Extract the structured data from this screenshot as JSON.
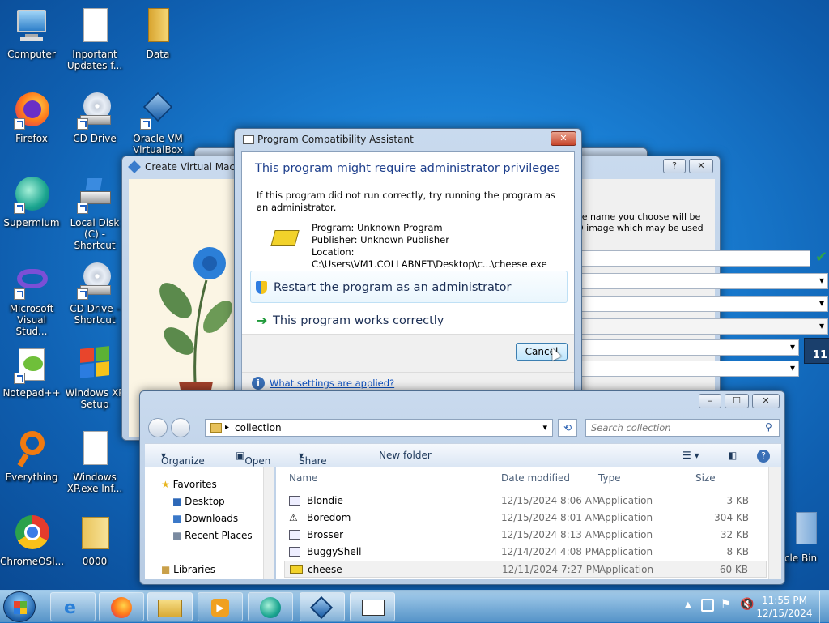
{
  "desktop_icons": [
    {
      "label": "Computer"
    },
    {
      "label": "Inportant Updates f..."
    },
    {
      "label": "Data"
    },
    {
      "label": "Firefox"
    },
    {
      "label": "CD Drive"
    },
    {
      "label": "Oracle VM VirtualBox"
    },
    {
      "label": "Supermium"
    },
    {
      "label": "Local Disk (C) - Shortcut"
    },
    {
      "label": "Microsoft Visual Stud..."
    },
    {
      "label": "CD Drive - Shortcut"
    },
    {
      "label": "Notepad++"
    },
    {
      "label": "Windows XP Setup"
    },
    {
      "label": "Everything"
    },
    {
      "label": "Windows XP.exe Inf..."
    },
    {
      "label": "ChromeOSI..."
    },
    {
      "label": "0000"
    },
    {
      "label": "cle Bin"
    }
  ],
  "pca": {
    "title": "Program Compatibility Assistant",
    "heading": "This program might require administrator privileges",
    "description": "If this program did not run correctly, try running the program as an administrator.",
    "program": "Program: Unknown Program",
    "publisher": "Publisher: Unknown Publisher",
    "location": "Location: C:\\Users\\VM1.COLLABNET\\Desktop\\c...\\cheese.exe",
    "option_restart": "Restart the program as an administrator",
    "option_works": "This program works correctly",
    "cancel": "Cancel",
    "settings_link": "What settings are applied?"
  },
  "cvm": {
    "title": "Create Virtual Machi",
    "help": "?",
    "hint_line1": "The name you choose will be",
    "hint_line2": "SO image which may be used",
    "badge": "11"
  },
  "explorer": {
    "address": "collection",
    "search_placeholder": "Search collection",
    "cmd": {
      "organize": "Organize",
      "open": "Open",
      "share": "Share with",
      "new_folder": "New folder"
    },
    "nav": {
      "favorites": "Favorites",
      "desktop": "Desktop",
      "downloads": "Downloads",
      "recent": "Recent Places",
      "libraries": "Libraries"
    },
    "columns": {
      "name": "Name",
      "date": "Date modified",
      "type": "Type",
      "size": "Size"
    },
    "rows": [
      {
        "name": "Blondie",
        "date": "12/15/2024 8:06 AM",
        "type": "Application",
        "size": "3 KB"
      },
      {
        "name": "Boredom",
        "date": "12/15/2024 8:01 AM",
        "type": "Application",
        "size": "304 KB"
      },
      {
        "name": "Brosser",
        "date": "12/15/2024 8:13 AM",
        "type": "Application",
        "size": "32 KB"
      },
      {
        "name": "BuggyShell",
        "date": "12/14/2024 4:08 PM",
        "type": "Application",
        "size": "8 KB"
      },
      {
        "name": "cheese",
        "date": "12/11/2024 7:27 PM",
        "type": "Application",
        "size": "60 KB"
      }
    ]
  },
  "clock": {
    "time": "11:55 PM",
    "date": "12/15/2024"
  }
}
